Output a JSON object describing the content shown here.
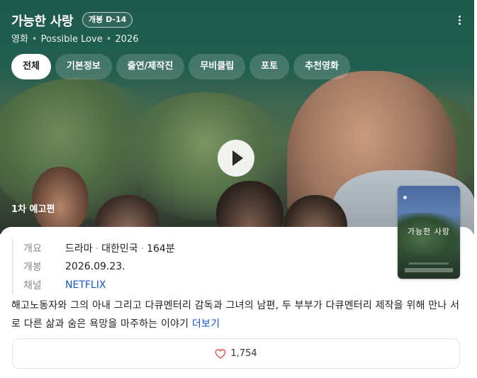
{
  "header": {
    "title": "가능한 사랑",
    "badge": "개봉 D-14",
    "meta": [
      "영화",
      "Possible Love",
      "2026"
    ]
  },
  "tabs": [
    {
      "label": "전체",
      "active": true
    },
    {
      "label": "기본정보",
      "active": false
    },
    {
      "label": "출연/제작진",
      "active": false
    },
    {
      "label": "무비클립",
      "active": false
    },
    {
      "label": "포토",
      "active": false
    },
    {
      "label": "추천영화",
      "active": false
    }
  ],
  "video": {
    "label": "1차 예고편"
  },
  "info": {
    "overview_key": "개요",
    "genre": "드라마",
    "country": "대한민국",
    "runtime": "164분",
    "release_key": "개봉",
    "release_date": "2026.09.23.",
    "channel_key": "채널",
    "channel": "NETFLIX"
  },
  "poster": {
    "title": "가능한 사랑"
  },
  "synopsis": {
    "text": "해고노동자와 그의 아내 그리고 다큐멘터리 감독과 그녀의 남편, 두 부부가 다큐멘터리 제작을 위해 만나 서로 다른 삶과 숨은 욕망을 마주하는 이야기",
    "more_label": "더보기"
  },
  "like": {
    "count": "1,754"
  },
  "colors": {
    "header_bg": "#215e4f",
    "link": "#1155cc",
    "heart": "#e53935"
  }
}
